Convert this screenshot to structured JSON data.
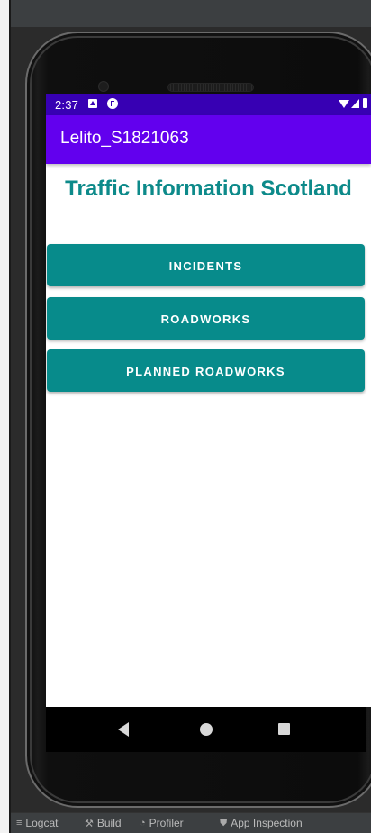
{
  "status_bar": {
    "time": "2:37"
  },
  "app_bar": {
    "title": "Lelito_S1821063"
  },
  "main": {
    "heading": "Traffic Information Scotland",
    "buttons": [
      {
        "label": "INCIDENTS"
      },
      {
        "label": "ROADWORKS"
      },
      {
        "label": "PLANNED ROADWORKS"
      }
    ]
  },
  "ide_toolbar": {
    "tabs": [
      {
        "label": "Logcat",
        "icon": "logcat-icon"
      },
      {
        "label": "Build",
        "icon": "hammer-icon"
      },
      {
        "label": "Profiler",
        "icon": "gauge-icon"
      },
      {
        "label": "App Inspection",
        "icon": "inspection-icon"
      }
    ]
  },
  "colors": {
    "status_bar": "#3700b3",
    "app_bar": "#6200ee",
    "accent": "#078b8b",
    "heading": "#0d8a8a"
  }
}
